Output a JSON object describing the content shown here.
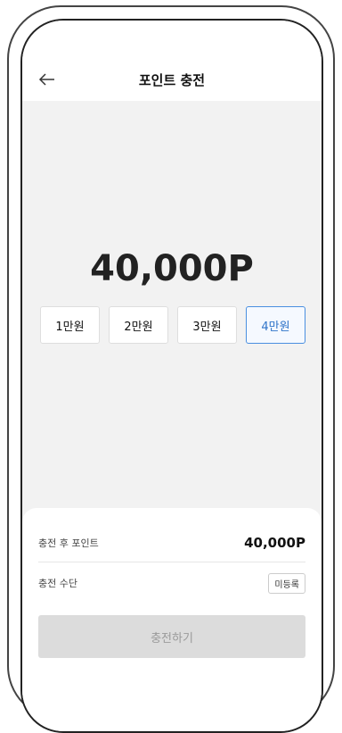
{
  "header": {
    "title": "포인트 충전",
    "back_icon": "back-arrow-icon"
  },
  "main": {
    "amount": "40,000P",
    "options": [
      {
        "label": "1만원",
        "selected": false
      },
      {
        "label": "2만원",
        "selected": false
      },
      {
        "label": "3만원",
        "selected": false
      },
      {
        "label": "4만원",
        "selected": true
      }
    ]
  },
  "summary": {
    "after_points_label": "충전 후 포인트",
    "after_points_value": "40,000P",
    "method_label": "충전 수단",
    "method_value": "미등록"
  },
  "actions": {
    "charge_label": "충전하기"
  },
  "colors": {
    "accent": "#2f74c9",
    "selected_border": "#4a8fe0",
    "disabled_button": "#dcdcdc"
  }
}
